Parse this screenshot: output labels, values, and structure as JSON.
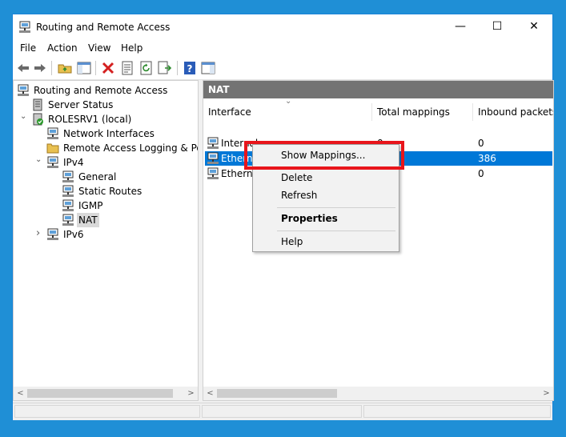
{
  "window": {
    "title": "Routing and Remote Access",
    "minimize_glyph": "—",
    "maximize_glyph": "☐",
    "close_glyph": "✕"
  },
  "menubar": {
    "items": [
      "File",
      "Action",
      "View",
      "Help"
    ]
  },
  "toolbar": {
    "icons": [
      "back-arrow-icon",
      "forward-arrow-icon",
      "up-folder-icon",
      "show-hide-console-tree-icon",
      "delete-icon",
      "properties-icon",
      "refresh-icon",
      "export-list-icon",
      "help-icon",
      "show-hide-action-pane-icon"
    ],
    "delete_color": "#d42020",
    "help_color": "#2a5cb8"
  },
  "tree": {
    "items": [
      {
        "label": "Routing and Remote Access",
        "icon": "server-icon"
      },
      {
        "label": "Server Status",
        "icon": "server-status-icon"
      },
      {
        "label": "ROLESRV1 (local)",
        "icon": "local-server-icon",
        "expander": "⌄"
      },
      {
        "label": "Network Interfaces",
        "icon": "network-interfaces-icon"
      },
      {
        "label": "Remote Access Logging & Policies",
        "icon": "folder-icon"
      },
      {
        "label": "IPv4",
        "icon": "ipv4-icon",
        "expander": "⌄"
      },
      {
        "label": "General",
        "icon": "general-icon"
      },
      {
        "label": "Static Routes",
        "icon": "static-routes-icon"
      },
      {
        "label": "IGMP",
        "icon": "igmp-icon"
      },
      {
        "label": "NAT",
        "icon": "nat-icon",
        "selected": true
      },
      {
        "label": "IPv6",
        "icon": "ipv6-icon",
        "expander": "›"
      }
    ]
  },
  "list": {
    "header": "NAT",
    "sort_glyph": "⌄",
    "columns": [
      "Interface",
      "Total mappings",
      "Inbound packets t"
    ],
    "rows": [
      {
        "interface": "Internal",
        "total": "0",
        "inbound": "0"
      },
      {
        "interface": "Etherne",
        "total": "",
        "inbound": "386",
        "selected": true
      },
      {
        "interface": "Etherne",
        "total": "",
        "inbound": "0"
      }
    ]
  },
  "scroll": {
    "left_glyph": "<",
    "right_glyph": ">"
  },
  "context_menu": {
    "items": [
      "Show Mappings...",
      "Delete",
      "Refresh",
      "Properties",
      "Help"
    ]
  },
  "colors": {
    "selection": "#0078d7",
    "highlight_box": "#e8151b",
    "pane_header": "#737373"
  }
}
